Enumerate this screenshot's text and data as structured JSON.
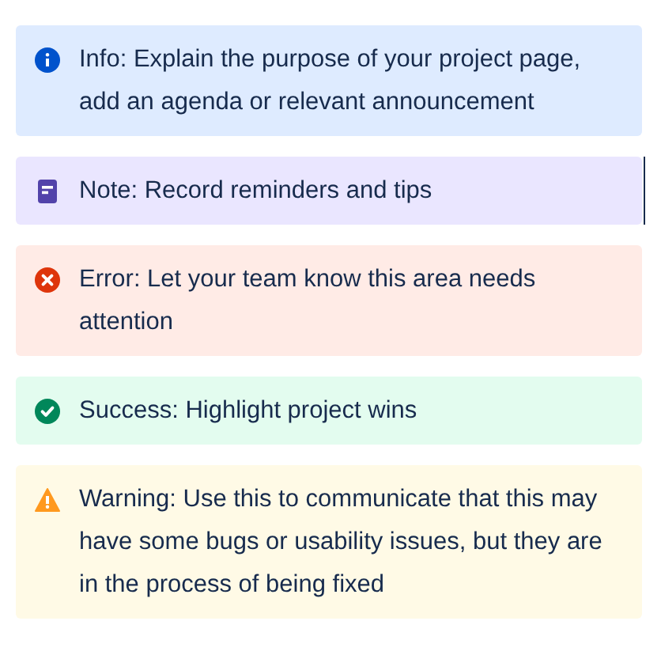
{
  "panels": [
    {
      "kind": "info",
      "text": "Info: Explain the purpose of your project page, add an agenda or relevant announcement"
    },
    {
      "kind": "note",
      "text": "Note: Record reminders and tips"
    },
    {
      "kind": "error",
      "text": "Error: Let your team know this area needs attention"
    },
    {
      "kind": "success",
      "text": "Success: Highlight project wins"
    },
    {
      "kind": "warning",
      "text": "Warning: Use this to communicate that this may have some bugs or usability issues, but they are in the process of being fixed"
    }
  ]
}
